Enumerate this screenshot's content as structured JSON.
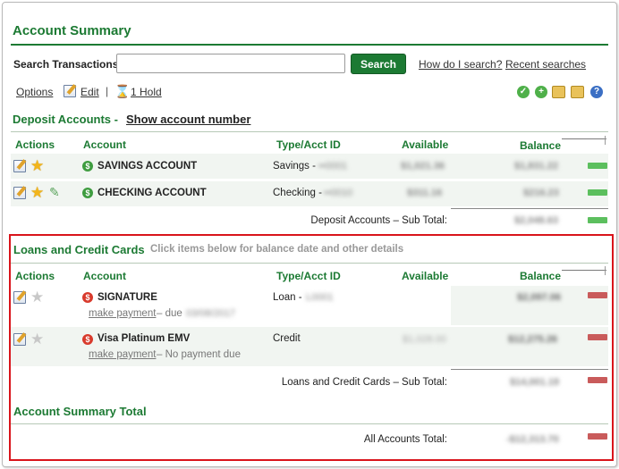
{
  "page_title": "Account Summary",
  "search": {
    "label": "Search Transactions:",
    "value": "",
    "button": "Search",
    "help_link": "How do I search?",
    "recent_link": "Recent searches"
  },
  "toolbar": {
    "options": "Options",
    "edit": "Edit",
    "separator": "|",
    "hold": "1 Hold",
    "icons": [
      "check-icon",
      "add-icon",
      "box-icon",
      "box-add-icon",
      "help-icon"
    ]
  },
  "deposit": {
    "title": "Deposit Accounts -",
    "show_link": "Show account number",
    "columns": {
      "actions": "Actions",
      "account": "Account",
      "type": "Type/Acct ID",
      "available": "Available",
      "balance": "Balance"
    },
    "accounts": [
      {
        "name": "SAVINGS ACCOUNT",
        "type": "Savings -",
        "acct_id": "••0001",
        "available": "$1,021.36",
        "balance": "$1,831.22",
        "bar_fraction": 0.85
      },
      {
        "name": "CHECKING ACCOUNT",
        "type": "Checking -",
        "acct_id": "••0010",
        "available": "$311.16",
        "balance": "$216.23",
        "bar_fraction": 0.85
      }
    ],
    "subtotal_label": "Deposit Accounts – Sub Total:",
    "subtotal_value": "$2,048.63",
    "subtotal_bar_fraction": 0.85
  },
  "loans": {
    "title": "Loans and Credit Cards",
    "subtitle": "Click items below for balance date and other details",
    "columns": {
      "actions": "Actions",
      "account": "Account",
      "type": "Type/Acct ID",
      "available": "Available",
      "balance": "Balance"
    },
    "accounts": [
      {
        "name": "SIGNATURE",
        "type": "Loan -",
        "acct_id": "L0001",
        "available": "",
        "balance": "$2,097.06",
        "payment_link": "make payment",
        "payment_note": "– due",
        "due_date": "03/08/2017",
        "bar_fraction": 0.85
      },
      {
        "name": "Visa Platinum EMV",
        "type": "Credit",
        "acct_id": "",
        "available": "$1,028.00",
        "balance": "$12,275.26",
        "payment_link": "make payment",
        "payment_note": "– No payment due",
        "due_date": "",
        "bar_fraction": 0.85
      }
    ],
    "subtotal_label": "Loans and Credit Cards – Sub Total:",
    "subtotal_value": "$14,001.19",
    "subtotal_bar_fraction": 0.85
  },
  "summary_total": {
    "title": "Account Summary Total",
    "label": "All Accounts Total:",
    "value": "-$12,313.70",
    "bar_fraction": 0.85
  },
  "colors": {
    "brand_green": "#1c7a33",
    "positive_bar": "#5cbf5e",
    "negative_bar": "#c95b5b",
    "highlight_box": "#d9141b"
  }
}
